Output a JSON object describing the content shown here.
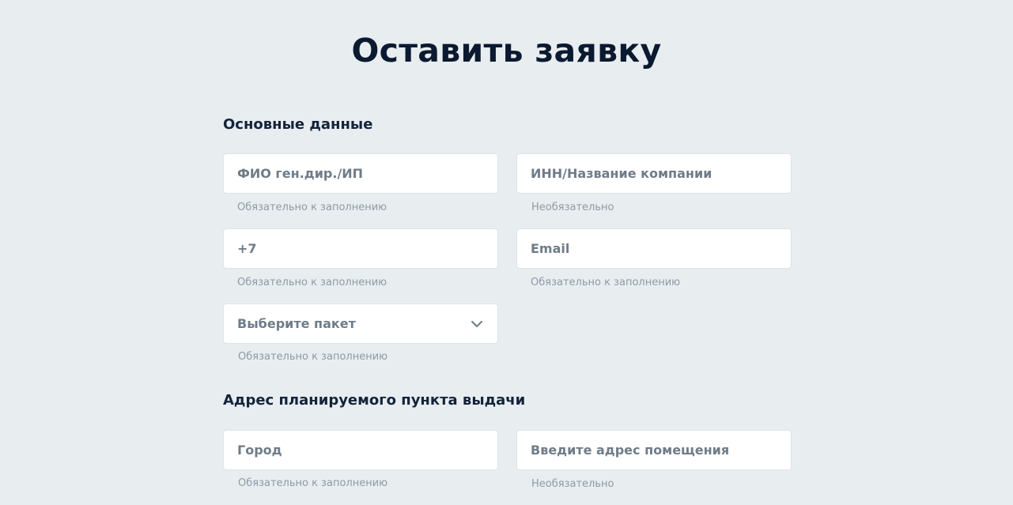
{
  "page": {
    "title": "Оставить заявку"
  },
  "sections": {
    "basic": {
      "title": "Основные данные",
      "fields": {
        "fio": {
          "placeholder": "ФИО ген.дир./ИП",
          "hint": "Обязательно к заполнению"
        },
        "inn": {
          "placeholder": "ИНН/Название компании",
          "hint": "Необязательно"
        },
        "phone": {
          "placeholder": "+7",
          "hint": "Обязательно к заполнению"
        },
        "email": {
          "placeholder": "Email",
          "hint": "Обязательно к заполнению"
        },
        "package": {
          "value": "Выберите пакет",
          "hint": "Обязательно к заполнению",
          "icon": "chevron-down-icon"
        }
      }
    },
    "address": {
      "title": "Адрес планируемого пункта выдачи",
      "fields": {
        "city": {
          "placeholder": "Город",
          "hint": "Обязательно к заполнению"
        },
        "premises": {
          "placeholder": "Введите адрес помещения",
          "hint": "Необязательно"
        }
      }
    }
  },
  "colors": {
    "background": "#e8edf0",
    "heading": "#0b1a30",
    "placeholder": "#6f7c88",
    "hint": "#8f9aa5",
    "field_border": "#dde3e8"
  }
}
